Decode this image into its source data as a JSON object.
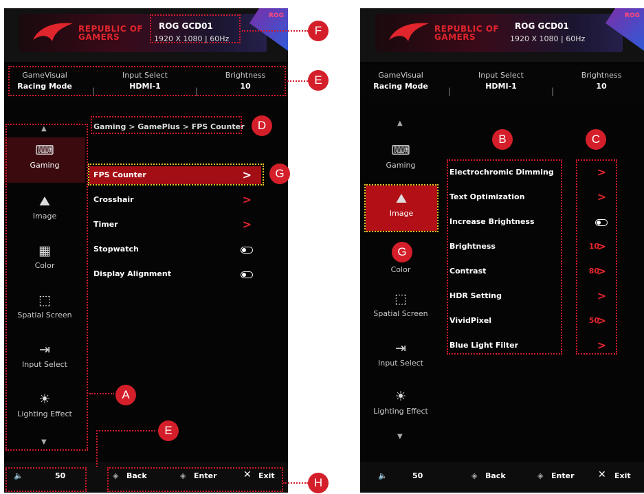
{
  "header": {
    "brand_line1": "REPUBLIC OF",
    "brand_line2": "GAMERS",
    "model": "ROG GCD01",
    "resolution": "1920 X 1080",
    "refresh": "60Hz",
    "corner_logo": "ROG"
  },
  "status": [
    {
      "label": "GameVisual",
      "value": "Racing Mode"
    },
    {
      "label": "Input Select",
      "value": "HDMI-1"
    },
    {
      "label": "Brightness",
      "value": "10"
    }
  ],
  "sidebar": [
    {
      "label": "Gaming",
      "icon": "gamepad-icon",
      "glyph": "⌨"
    },
    {
      "label": "Image",
      "icon": "image-icon",
      "glyph": "⛰"
    },
    {
      "label": "Color",
      "icon": "color-icon",
      "glyph": "▦"
    },
    {
      "label": "Spatial Screen",
      "icon": "spatial-screen-icon",
      "glyph": "⬚"
    },
    {
      "label": "Input Select",
      "icon": "input-select-icon",
      "glyph": "⇥"
    },
    {
      "label": "Lighting Effect",
      "icon": "lighting-effect-icon",
      "glyph": "☀"
    }
  ],
  "left_panel": {
    "breadcrumb": "Gaming > GamePlus > FPS Counter",
    "menu": [
      "FPS Counter",
      "Crosshair",
      "Timer",
      "Stopwatch",
      "Display Alignment"
    ]
  },
  "right_panel": {
    "menu": [
      {
        "label": "Electrochromic Dimming",
        "value": ""
      },
      {
        "label": "Text Optimization",
        "value": ""
      },
      {
        "label": "Increase Brightness",
        "value": ""
      },
      {
        "label": "Brightness",
        "value": "10"
      },
      {
        "label": "Contrast",
        "value": "80"
      },
      {
        "label": "HDR Setting",
        "value": ""
      },
      {
        "label": "VividPixel",
        "value": "50"
      },
      {
        "label": "Blue Light Filter",
        "value": ""
      }
    ]
  },
  "footer": {
    "volume": "50",
    "back": "Back",
    "enter": "Enter",
    "exit": "Exit"
  },
  "callouts": [
    "A",
    "B",
    "C",
    "D",
    "E",
    "F",
    "G",
    "H"
  ],
  "colors": {
    "accent": "#d41f2a",
    "highlight_dots": "#e8c22a",
    "selected_bg": "#a30e14"
  }
}
